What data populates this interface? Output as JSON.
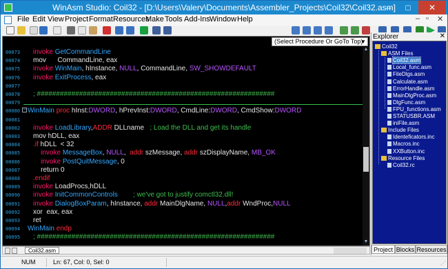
{
  "window": {
    "title": "WinAsm Studio: Coil32 - [D:\\Users\\Valery\\Documents\\Assembler_Projects\\Coil32\\Coil32.asm]",
    "controls": [
      "–",
      "□",
      "✕"
    ]
  },
  "menu": [
    "File",
    "Edit",
    "View",
    "Project",
    "Format",
    "Resources",
    "Make",
    "Tools",
    "Add-Ins",
    "Window",
    "Help"
  ],
  "mdi_controls": [
    "–",
    "▫",
    "✕"
  ],
  "editor": {
    "proc_combo": "(Select Procedure Or GoTo Top)",
    "file_tab": "Coil32.asm",
    "lines": [
      {
        "num": "00073",
        "tokens": [
          {
            "c": "kw-invoke",
            "t": "invoke "
          },
          {
            "c": "api",
            "t": "GetCommandLine"
          }
        ]
      },
      {
        "num": "00074",
        "tokens": [
          {
            "c": "plain",
            "t": "mov      CommandLine, eax"
          }
        ]
      },
      {
        "num": "00075",
        "tokens": [
          {
            "c": "kw-invoke",
            "t": "invoke "
          },
          {
            "c": "api",
            "t": "WinMain"
          },
          {
            "c": "plain",
            "t": ", hInstance, "
          },
          {
            "c": "const",
            "t": "NULL"
          },
          {
            "c": "plain",
            "t": ", CommandLine, "
          },
          {
            "c": "const",
            "t": "SW_SHOWDEFAULT"
          }
        ]
      },
      {
        "num": "00076",
        "tokens": [
          {
            "c": "kw-invoke",
            "t": "invoke "
          },
          {
            "c": "api",
            "t": "ExitProcess"
          },
          {
            "c": "plain",
            "t": ", eax"
          }
        ]
      },
      {
        "num": "00077",
        "tokens": []
      },
      {
        "num": "00078",
        "tokens": [
          {
            "c": "comment",
            "t": "; ##############################################################"
          }
        ]
      },
      {
        "num": "00079",
        "tokens": []
      },
      {
        "num": "00080",
        "tokens": [
          {
            "c": "proc",
            "t": "WinMain "
          },
          {
            "c": "kw-red",
            "t": "proc "
          },
          {
            "c": "plain",
            "t": "hInst:"
          },
          {
            "c": "const",
            "t": "DWORD"
          },
          {
            "c": "plain",
            "t": ", hPrevInst:"
          },
          {
            "c": "const",
            "t": "DWORD"
          },
          {
            "c": "plain",
            "t": ", CmdLine:"
          },
          {
            "c": "const",
            "t": "DWORD"
          },
          {
            "c": "plain",
            "t": ", CmdShow:"
          },
          {
            "c": "const",
            "t": "DWORD"
          }
        ]
      },
      {
        "num": "00081",
        "tokens": []
      },
      {
        "num": "00082",
        "tokens": [
          {
            "c": "kw-invoke",
            "t": "invoke "
          },
          {
            "c": "api",
            "t": "LoadLibrary"
          },
          {
            "c": "plain",
            "t": ","
          },
          {
            "c": "kw-red",
            "t": "ADDR "
          },
          {
            "c": "plain",
            "t": "DLLname   "
          },
          {
            "c": "comment",
            "t": "; Load the DLL and get its handle"
          }
        ]
      },
      {
        "num": "00083",
        "tokens": [
          {
            "c": "plain",
            "t": "mov hDLL, eax"
          }
        ]
      },
      {
        "num": "00084",
        "tokens": [
          {
            "c": "kw-red",
            "t": ".if "
          },
          {
            "c": "plain",
            "t": "hDLL  < 32"
          }
        ]
      },
      {
        "num": "00085",
        "tokens": [
          {
            "c": "plain",
            "t": "    "
          },
          {
            "c": "kw-invoke",
            "t": "invoke "
          },
          {
            "c": "api",
            "t": "MessageBox"
          },
          {
            "c": "plain",
            "t": ", "
          },
          {
            "c": "const",
            "t": "NULL"
          },
          {
            "c": "plain",
            "t": ",  "
          },
          {
            "c": "kw-red",
            "t": "addr "
          },
          {
            "c": "plain",
            "t": "szMessage, "
          },
          {
            "c": "kw-red",
            "t": "addr "
          },
          {
            "c": "plain",
            "t": "szDisplayName, "
          },
          {
            "c": "const",
            "t": "MB_OK"
          }
        ]
      },
      {
        "num": "00086",
        "tokens": [
          {
            "c": "plain",
            "t": "    "
          },
          {
            "c": "kw-invoke",
            "t": "invoke "
          },
          {
            "c": "api",
            "t": "PostQuitMessage"
          },
          {
            "c": "plain",
            "t": ", 0"
          }
        ]
      },
      {
        "num": "00087",
        "tokens": [
          {
            "c": "plain",
            "t": "    return 0"
          }
        ]
      },
      {
        "num": "00088",
        "tokens": [
          {
            "c": "kw-red",
            "t": ".endif"
          }
        ]
      },
      {
        "num": "00089",
        "tokens": [
          {
            "c": "kw-invoke",
            "t": "invoke "
          },
          {
            "c": "plain",
            "t": "LoadProcs,hDLL"
          }
        ]
      },
      {
        "num": "00090",
        "tokens": [
          {
            "c": "kw-invoke",
            "t": "invoke "
          },
          {
            "c": "api",
            "t": "InitCommonControls"
          },
          {
            "c": "plain",
            "t": "        "
          },
          {
            "c": "comment",
            "t": "; we've got to justify comctl32.dll!"
          }
        ]
      },
      {
        "num": "00091",
        "tokens": [
          {
            "c": "kw-invoke",
            "t": "invoke "
          },
          {
            "c": "api",
            "t": "DialogBoxParam"
          },
          {
            "c": "plain",
            "t": ", hInstance, "
          },
          {
            "c": "kw-red",
            "t": "addr "
          },
          {
            "c": "plain",
            "t": "MainDlgName, "
          },
          {
            "c": "const",
            "t": "NULL"
          },
          {
            "c": "plain",
            "t": ","
          },
          {
            "c": "kw-red",
            "t": "addr "
          },
          {
            "c": "plain",
            "t": "WndProc,"
          },
          {
            "c": "const",
            "t": "NULL"
          }
        ]
      },
      {
        "num": "00092",
        "tokens": [
          {
            "c": "plain",
            "t": "xor  eax, eax"
          }
        ]
      },
      {
        "num": "00093",
        "tokens": [
          {
            "c": "plain",
            "t": "ret"
          }
        ]
      },
      {
        "num": "00094",
        "tokens": [
          {
            "c": "proc",
            "t": "WinMain "
          },
          {
            "c": "kw-red",
            "t": "endp"
          }
        ]
      },
      {
        "num": "00095",
        "tokens": [
          {
            "c": "comment",
            "t": "; ##############################################################"
          }
        ]
      }
    ]
  },
  "explorer": {
    "title": "Explorer",
    "close": "✕",
    "tree": [
      {
        "label": "Coil32",
        "kind": "folder",
        "level": 0
      },
      {
        "label": "ASM Files",
        "kind": "folder",
        "level": 1
      },
      {
        "label": "Coil32.asm",
        "kind": "file",
        "level": 2,
        "selected": true
      },
      {
        "label": "Local_func.asm",
        "kind": "file",
        "level": 2
      },
      {
        "label": "FileDlgs.asm",
        "kind": "file",
        "level": 2
      },
      {
        "label": "Calculate.asm",
        "kind": "file",
        "level": 2
      },
      {
        "label": "ErrorHandle.asm",
        "kind": "file",
        "level": 2
      },
      {
        "label": "MainDlgProc.asm",
        "kind": "file",
        "level": 2
      },
      {
        "label": "DlgFunc.asm",
        "kind": "file",
        "level": 2
      },
      {
        "label": "FPU_functions.asm",
        "kind": "file",
        "level": 2
      },
      {
        "label": "STATUSBR.ASM",
        "kind": "file",
        "level": 2
      },
      {
        "label": "iniFile.asm",
        "kind": "file",
        "level": 2
      },
      {
        "label": "Include Files",
        "kind": "folder",
        "level": 1
      },
      {
        "label": "Identeficators.inc",
        "kind": "file",
        "level": 2
      },
      {
        "label": "Macros.inc",
        "kind": "file",
        "level": 2
      },
      {
        "label": "XXButton.inc",
        "kind": "file",
        "level": 2
      },
      {
        "label": "Resource Files",
        "kind": "folder",
        "level": 1
      },
      {
        "label": "Coil32.rc",
        "kind": "file",
        "level": 2
      }
    ],
    "tabs": [
      "Project",
      "Blocks",
      "Resources"
    ]
  },
  "status": {
    "mode": "NUM",
    "position": "Ln: 67, Col: 0, Sel: 0"
  },
  "colors": {
    "title_bar": "#1c89cf",
    "editor_bg": "#000000",
    "tree_bg": "#0a1a8e",
    "keyword": "#ff1a6a",
    "api": "#33a8ff",
    "comment": "#3fbf4e",
    "constant": "#b855ff"
  }
}
